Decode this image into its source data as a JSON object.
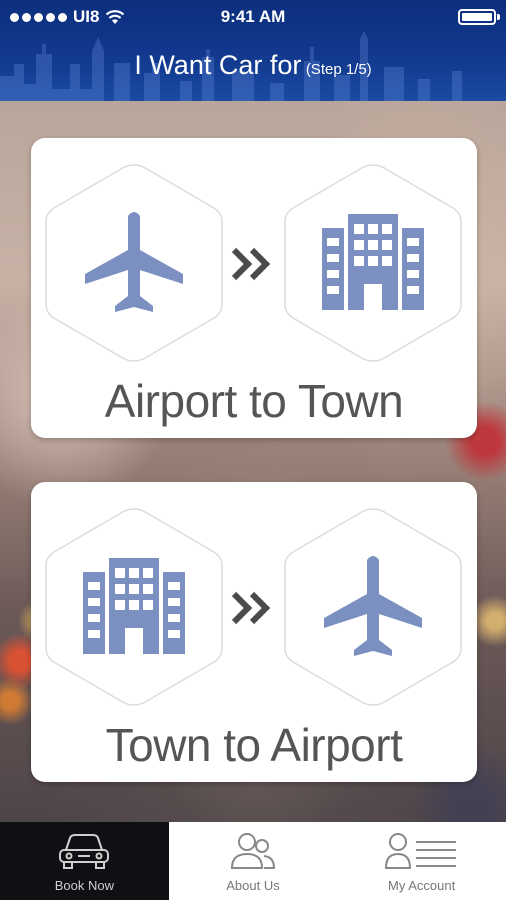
{
  "status_bar": {
    "carrier": "UI8",
    "time": "9:41 AM"
  },
  "header": {
    "title": "I Want Car for",
    "step": "(Step 1/5)"
  },
  "options": [
    {
      "label": "Airport to Town",
      "from_icon": "airplane-icon",
      "to_icon": "building-icon"
    },
    {
      "label": "Town to Airport",
      "from_icon": "building-icon",
      "to_icon": "airplane-icon"
    }
  ],
  "tabs": [
    {
      "label": "Book Now",
      "icon": "car-icon",
      "active": true
    },
    {
      "label": "About Us",
      "icon": "users-icon",
      "active": false
    },
    {
      "label": "My Account",
      "icon": "account-icon",
      "active": false
    }
  ],
  "colors": {
    "header": "#123a8f",
    "icon": "#7b8fc0",
    "arrow": "#4a4a4a",
    "tab_active": "#0f1014"
  }
}
